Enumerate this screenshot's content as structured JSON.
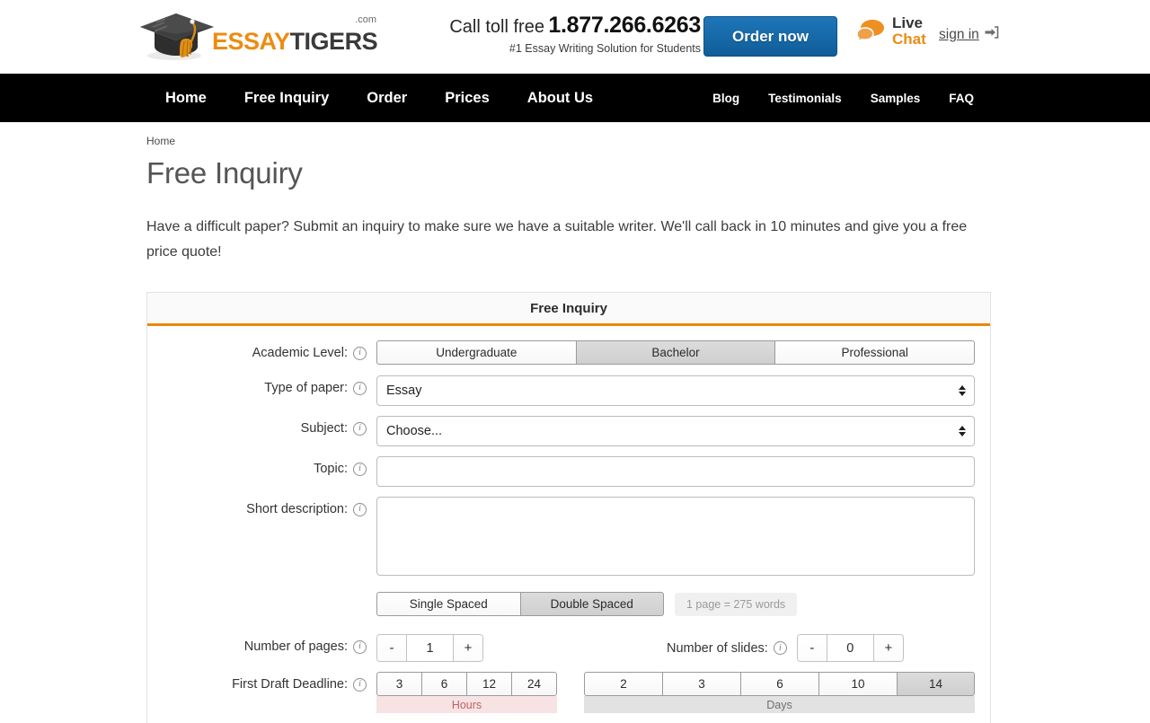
{
  "header": {
    "logo": {
      "primary": "ESSAY",
      "secondary": "TIGERS",
      "tld": ".com",
      "icon": "graduation-cap-icon"
    },
    "phone_label": "Call toll free",
    "phone_number": "1.877.266.6263",
    "tagline": "#1 Essay Writing Solution for Students",
    "order_button": "Order now",
    "live_chat": {
      "line1": "Live",
      "line2": "Chat",
      "icon": "chat-bubbles-icon"
    },
    "sign_in": {
      "label": "sign in",
      "icon": "sign-in-arrow-icon"
    },
    "colors": {
      "accent_orange": "#ec8c11",
      "order_blue": "#1f76b8",
      "nav_black": "#000000"
    }
  },
  "nav": {
    "primary": [
      "Home",
      "Free Inquiry",
      "Order",
      "Prices",
      "About Us"
    ],
    "secondary": [
      "Blog",
      "Testimonials",
      "Samples",
      "FAQ"
    ]
  },
  "breadcrumb": [
    "Home"
  ],
  "page": {
    "title": "Free Inquiry",
    "intro": "Have a difficult paper? Submit an inquiry to make sure we have a suitable writer. We'll call back in 10 minutes and give you a free price quote!"
  },
  "form": {
    "panel_title": "Free Inquiry",
    "academic_level": {
      "label": "Academic Level:",
      "options": [
        "Undergraduate",
        "Bachelor",
        "Professional"
      ],
      "selected": "Bachelor"
    },
    "type_of_paper": {
      "label": "Type of paper:",
      "value": "Essay"
    },
    "subject": {
      "label": "Subject:",
      "value": "Choose..."
    },
    "topic": {
      "label": "Topic:",
      "value": "",
      "placeholder": ""
    },
    "short_description": {
      "label": "Short description:",
      "value": "",
      "placeholder": ""
    },
    "spacing": {
      "options": [
        "Single Spaced",
        "Double Spaced"
      ],
      "selected": "Double Spaced",
      "note": "1 page = 275 words"
    },
    "number_of_pages": {
      "label": "Number of pages:",
      "value": "1",
      "decrement": "-",
      "increment": "+"
    },
    "number_of_slides": {
      "label": "Number of slides:",
      "value": "0",
      "decrement": "-",
      "increment": "+"
    },
    "first_draft_deadline": {
      "label": "First Draft Deadline:",
      "hours": {
        "caption": "Hours",
        "options": [
          "3",
          "6",
          "12",
          "24"
        ],
        "selected": null
      },
      "days": {
        "caption": "Days",
        "options": [
          "2",
          "3",
          "6",
          "10",
          "14"
        ],
        "selected": "14"
      }
    }
  }
}
